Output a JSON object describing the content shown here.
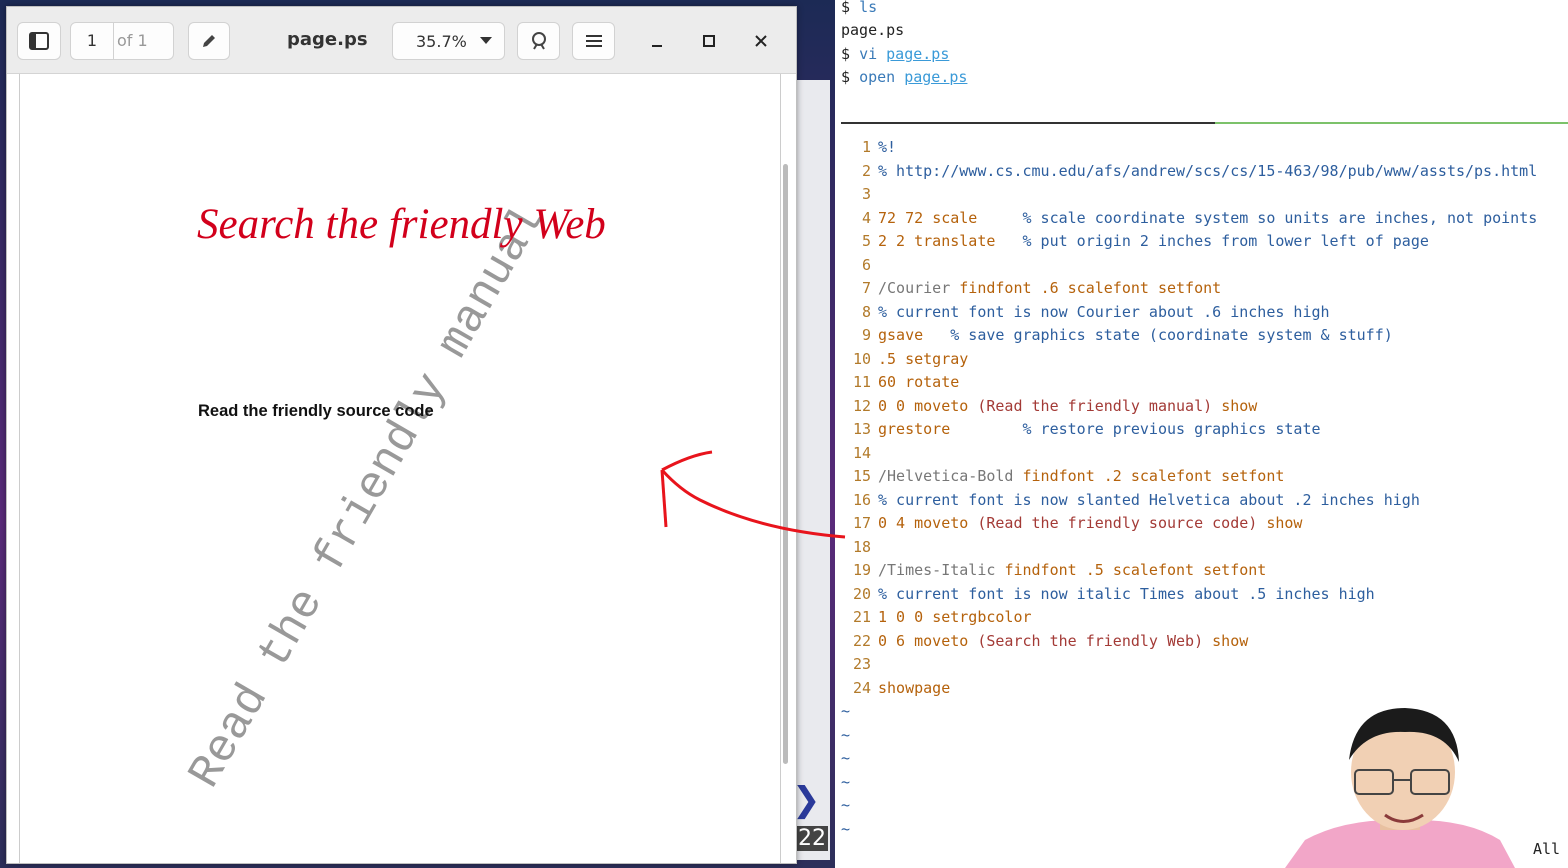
{
  "viewer": {
    "page_number": "1",
    "page_of": "of 1",
    "title": "page.ps",
    "zoom": "35.7%",
    "icons": {
      "sidebar": "sidebar-toggle-icon",
      "annotate": "pencil-icon",
      "find": "search-icon",
      "menu": "hamburger-menu-icon",
      "minimize": "minimize-icon",
      "maximize": "maximize-icon",
      "close": "close-icon"
    },
    "document": {
      "web_text": "Search the friendly Web",
      "source_text": "Read the friendly source code",
      "manual_text": "Read the friendly manual",
      "web_color": "#d2001b"
    }
  },
  "terminal": {
    "history": [
      {
        "prompt": "$ ",
        "cmd": "ls",
        "arg": ""
      },
      {
        "output": "page.ps"
      },
      {
        "prompt": "$ ",
        "cmd": "vi",
        "arg": "page.ps"
      },
      {
        "prompt": "$ ",
        "cmd": "open",
        "arg": "page.ps"
      }
    ],
    "lines": [
      {
        "n": "1",
        "segs": [
          [
            "c-com",
            "%!"
          ]
        ]
      },
      {
        "n": "2",
        "segs": [
          [
            "c-com",
            "% http://www.cs.cmu.edu/afs/andrew/scs/cs/15-463/98/pub/www/assts/ps.html"
          ]
        ]
      },
      {
        "n": "3",
        "segs": []
      },
      {
        "n": "4",
        "segs": [
          [
            "c-num",
            "72 72 "
          ],
          [
            "c-op",
            "scale"
          ],
          [
            "",
            "     "
          ],
          [
            "c-com",
            "% scale coordinate system so units are inches, not points"
          ]
        ]
      },
      {
        "n": "5",
        "segs": [
          [
            "c-num",
            "2 2 "
          ],
          [
            "c-op",
            "translate"
          ],
          [
            "",
            "   "
          ],
          [
            "c-com",
            "% put origin 2 inches from lower left of page"
          ]
        ]
      },
      {
        "n": "6",
        "segs": []
      },
      {
        "n": "7",
        "segs": [
          [
            "c-def",
            "/Courier "
          ],
          [
            "c-op",
            "findfont "
          ],
          [
            "c-num",
            ".6 "
          ],
          [
            "c-op",
            "scalefont setfont"
          ]
        ]
      },
      {
        "n": "8",
        "segs": [
          [
            "c-com",
            "% current font is now Courier about .6 inches high"
          ]
        ]
      },
      {
        "n": "9",
        "segs": [
          [
            "c-op",
            "gsave"
          ],
          [
            "",
            "   "
          ],
          [
            "c-com",
            "% save graphics state (coordinate system & stuff)"
          ]
        ]
      },
      {
        "n": "10",
        "segs": [
          [
            "c-num",
            ".5 "
          ],
          [
            "c-op",
            "setgray"
          ]
        ]
      },
      {
        "n": "11",
        "segs": [
          [
            "c-num",
            "60 "
          ],
          [
            "c-op",
            "rotate"
          ]
        ]
      },
      {
        "n": "12",
        "segs": [
          [
            "c-num",
            "0 0 "
          ],
          [
            "c-op",
            "moveto "
          ],
          [
            "c-str",
            "(Read the friendly manual) "
          ],
          [
            "c-op",
            "show"
          ]
        ]
      },
      {
        "n": "13",
        "segs": [
          [
            "c-op",
            "grestore"
          ],
          [
            "",
            "        "
          ],
          [
            "c-com",
            "% restore previous graphics state"
          ]
        ]
      },
      {
        "n": "14",
        "segs": []
      },
      {
        "n": "15",
        "segs": [
          [
            "c-def",
            "/Helvetica-Bold "
          ],
          [
            "c-op",
            "findfont "
          ],
          [
            "c-num",
            ".2 "
          ],
          [
            "c-op",
            "scalefont setfont"
          ]
        ]
      },
      {
        "n": "16",
        "segs": [
          [
            "c-com",
            "% current font is now slanted Helvetica about .2 inches high"
          ]
        ]
      },
      {
        "n": "17",
        "segs": [
          [
            "c-num",
            "0 4 "
          ],
          [
            "c-op",
            "moveto "
          ],
          [
            "c-str",
            "(Read the friendly source code) "
          ],
          [
            "c-op",
            "show"
          ]
        ]
      },
      {
        "n": "18",
        "segs": []
      },
      {
        "n": "19",
        "segs": [
          [
            "c-def",
            "/Times-Italic "
          ],
          [
            "c-op",
            "findfont "
          ],
          [
            "c-num",
            ".5 "
          ],
          [
            "c-op",
            "scalefont setfont"
          ]
        ]
      },
      {
        "n": "20",
        "segs": [
          [
            "c-com",
            "% current font is now italic Times about .5 inches high"
          ]
        ]
      },
      {
        "n": "21",
        "segs": [
          [
            "c-num",
            "1 0 0 "
          ],
          [
            "c-op",
            "setrgbcolor"
          ]
        ]
      },
      {
        "n": "22",
        "segs": [
          [
            "c-num",
            "0 6 "
          ],
          [
            "c-op",
            "moveto "
          ],
          [
            "c-str",
            "(Search the friendly Web) "
          ],
          [
            "c-op",
            "show"
          ]
        ]
      },
      {
        "n": "23",
        "segs": []
      },
      {
        "n": "24",
        "segs": [
          [
            "c-op",
            "showpage"
          ]
        ]
      }
    ],
    "tilde": "~",
    "tilde_count": 6,
    "status": "All"
  },
  "background": {
    "badge": "22"
  }
}
